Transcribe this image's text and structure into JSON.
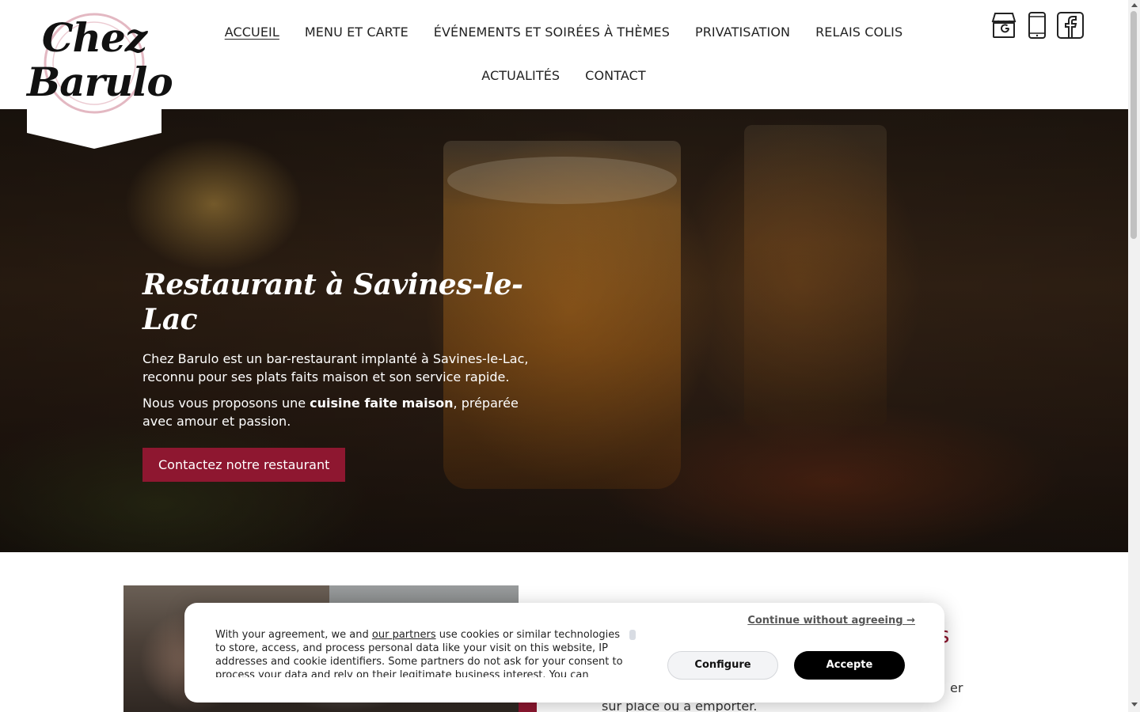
{
  "logo": {
    "line1": "Chez",
    "line2": "Barulo"
  },
  "nav": {
    "row1": [
      "ACCUEIL",
      "MENU ET CARTE",
      "ÉVÉNEMENTS ET SOIRÉES À THÈMES",
      "PRIVATISATION",
      "RELAIS COLIS"
    ],
    "row2": [
      "ACTUALITÉS",
      "CONTACT"
    ],
    "active": "ACCUEIL"
  },
  "social_icons": [
    "google-business-icon",
    "phone-icon",
    "facebook-icon"
  ],
  "hero": {
    "title": "Restaurant à Savines-le-Lac",
    "p1": "Chez Barulo est un bar-restaurant implanté à Savines-le-Lac, reconnu pour ses plats faits maison et son service rapide.",
    "p2_before": "Nous vous proposons une ",
    "p2_strong": "cuisine faite maison",
    "p2_after": ", préparée avec amour et passion.",
    "button": "Contactez notre restaurant"
  },
  "section": {
    "title_partial": "pas",
    "text_line1": "er",
    "text_line2": "sur place ou à emporter."
  },
  "cookie": {
    "text_before_link": "With your agreement, we and ",
    "link": "our partners",
    "text_after_link": " use cookies or similar technologies to store, access, and process personal data like your visit on this website, IP addresses and cookie identifiers. Some partners do not ask for your consent to process your data and rely on their legitimate business interest. You can",
    "continue": "Continue without agreeing →",
    "configure": "Configure",
    "accept": "Accepte"
  },
  "colors": {
    "accent": "#8e1730",
    "accept_bg": "#000000",
    "configure_bg": "#f3f4f6"
  }
}
